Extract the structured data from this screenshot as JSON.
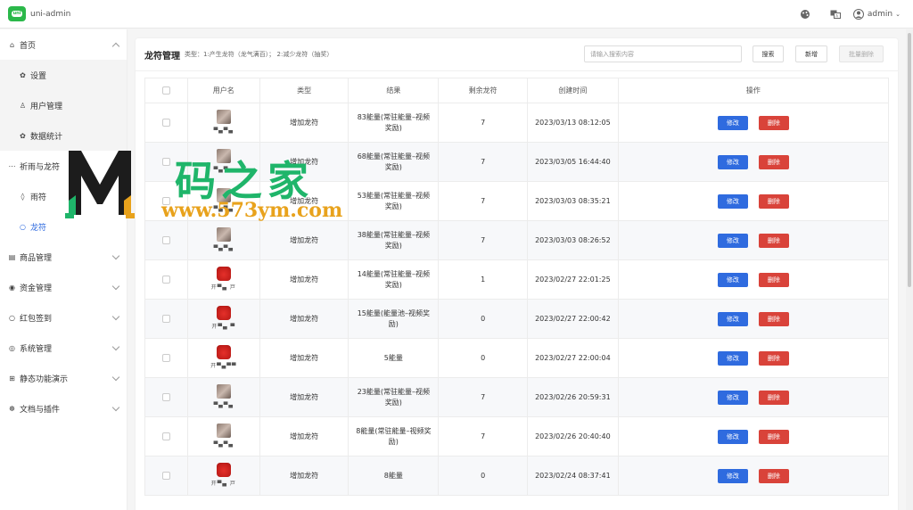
{
  "app": {
    "title": "uni-admin",
    "logo_text": "uni"
  },
  "topbar": {
    "user_name": "admin",
    "theme_icon": "palette-icon",
    "lang_icon": "translate-icon",
    "user_icon": "user-circle-icon"
  },
  "sidebar": {
    "items": [
      {
        "label": "首页",
        "icon": "home-icon",
        "level": 1,
        "expanded": true
      },
      {
        "label": "设置",
        "icon": "gear-icon",
        "level": 2
      },
      {
        "label": "用户管理",
        "icon": "person-icon",
        "level": 2
      },
      {
        "label": "数据统计",
        "icon": "gear-icon",
        "level": 2
      },
      {
        "label": "祈雨与龙符",
        "icon": "more-icon",
        "level": 1,
        "expanded": true
      },
      {
        "label": "雨符",
        "icon": "pin-icon",
        "level": 2
      },
      {
        "label": "龙符",
        "icon": "circle-icon",
        "level": 2,
        "active": true
      },
      {
        "label": "商品管理",
        "icon": "grid-icon",
        "level": 1
      },
      {
        "label": "资金管理",
        "icon": "eye-icon",
        "level": 1
      },
      {
        "label": "红包签到",
        "icon": "circle-icon",
        "level": 1
      },
      {
        "label": "系统管理",
        "icon": "settings-icon",
        "level": 1
      },
      {
        "label": "静态功能演示",
        "icon": "apps-icon",
        "level": 1
      },
      {
        "label": "文档与插件",
        "icon": "bug-icon",
        "level": 1
      }
    ]
  },
  "panel": {
    "title": "龙符管理",
    "subtitle": "类型：1:产生龙符（龙气满百）；  2:减少龙符（抽奖）",
    "search_placeholder": "请输入搜索内容",
    "search_label": "搜索",
    "add_label": "新增",
    "batch_delete_label": "批量删除"
  },
  "table": {
    "headers": [
      "用户名",
      "类型",
      "结果",
      "剩余龙符",
      "创建时间",
      "操作"
    ],
    "edit_label": "修改",
    "delete_label": "删除",
    "rows": [
      {
        "avatar": "gray",
        "user": "▀▄▀▄",
        "type": "增加龙符",
        "result": "83能量(常驻能量–视频奖励)",
        "remaining": "7",
        "created": "2023/03/13 08:12:05"
      },
      {
        "avatar": "gray",
        "user": "▀▄▀▄",
        "type": "增加龙符",
        "result": "68能量(常驻能量–视频奖励)",
        "remaining": "7",
        "created": "2023/03/05 16:44:40"
      },
      {
        "avatar": "gray",
        "user": "▀▄▀▄",
        "type": "增加龙符",
        "result": "53能量(常驻能量–视频奖励)",
        "remaining": "7",
        "created": "2023/03/03 08:35:21"
      },
      {
        "avatar": "gray",
        "user": "▀▄▀▄",
        "type": "增加龙符",
        "result": "38能量(常驻能量–视频奖励)",
        "remaining": "7",
        "created": "2023/03/03 08:26:52"
      },
      {
        "avatar": "red",
        "user": "开▀▄ 戸",
        "type": "增加龙符",
        "result": "14能量(常驻能量–视频奖励)",
        "remaining": "1",
        "created": "2023/02/27 22:01:25"
      },
      {
        "avatar": "red",
        "user": "开▀▄ ▀",
        "type": "增加龙符",
        "result": "15能量(能量池–视频奖励)",
        "remaining": "0",
        "created": "2023/02/27 22:00:42"
      },
      {
        "avatar": "red",
        "user": "开▀▄▀▀",
        "type": "增加龙符",
        "result": "5能量",
        "remaining": "0",
        "created": "2023/02/27 22:00:04"
      },
      {
        "avatar": "gray",
        "user": "▀▄▀▄",
        "type": "增加龙符",
        "result": "23能量(常驻能量–视频奖励)",
        "remaining": "7",
        "created": "2023/02/26 20:59:31"
      },
      {
        "avatar": "gray",
        "user": "▀▄▀▄",
        "type": "增加龙符",
        "result": "8能量(常驻能量–视频奖励)",
        "remaining": "7",
        "created": "2023/02/26 20:40:40"
      },
      {
        "avatar": "red",
        "user": "开▀▄ 戸",
        "type": "增加龙符",
        "result": "8能量",
        "remaining": "0",
        "created": "2023/02/24 08:37:41"
      }
    ]
  },
  "watermark": {
    "cn": "码之家",
    "url": "www.573ym.com"
  },
  "colors": {
    "primary": "#2f6bdf",
    "danger": "#d9433a",
    "brand_green": "#2bb84a"
  }
}
